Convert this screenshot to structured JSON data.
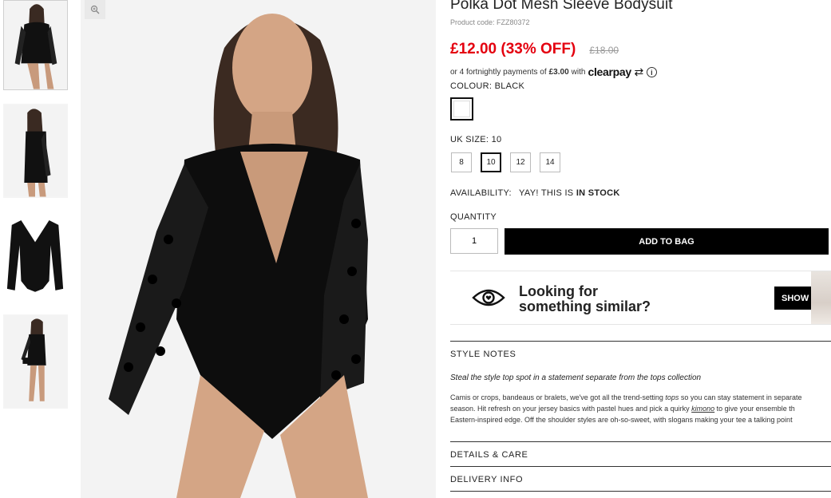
{
  "product": {
    "title": "Polka Dot Mesh Sleeve Bodysuit",
    "code": "Product code: FZZ80372",
    "price": "£12.00 (33% OFF)",
    "old_price": "£18.00"
  },
  "clearpay": {
    "prefix": "or 4 fortnightly payments of",
    "amount": "£3.00",
    "with": "with",
    "logo": "clearpay",
    "info_glyph": "i"
  },
  "colour": {
    "label": "COLOUR:",
    "value": "BLACK"
  },
  "size": {
    "label": "UK SIZE:",
    "value": "10",
    "options": [
      "8",
      "10",
      "12",
      "14"
    ]
  },
  "availability": {
    "label": "AVAILABILITY:",
    "text": "YAY! THIS IS",
    "status": "IN STOCK"
  },
  "quantity": {
    "label": "QUANTITY",
    "value": "1"
  },
  "add_to_bag": "ADD TO BAG",
  "similar": {
    "line1": "Looking for",
    "line2": "something similar?",
    "button": "SHOW SIMILAR"
  },
  "style_notes": {
    "heading": "STYLE NOTES",
    "subtitle": "Steal the style top spot in a statement separate from the tops collection",
    "line1a": "Camis or crops, bandeaus or bralets, we've got all the trend-setting ",
    "line1_em": "tops",
    "line1b": " so you can stay statement in separate",
    "line2a": "season. Hit refresh on your jersey basics with pastel hues and pick a quirky ",
    "line2_em": "kimono",
    "line2b": " to give your ensemble th",
    "line3": "Eastern-inspired edge. Off the shoulder styles are oh-so-sweet, with slogans making your tee a talking point"
  },
  "details_care": "DETAILS & CARE",
  "delivery_info": "DELIVERY INFO",
  "icons": {
    "zoom": "zoom-icon",
    "eye": "eye-heart-icon",
    "info": "info-icon"
  },
  "colors": {
    "sale": "#e4000f",
    "primary_button": "#000000"
  }
}
